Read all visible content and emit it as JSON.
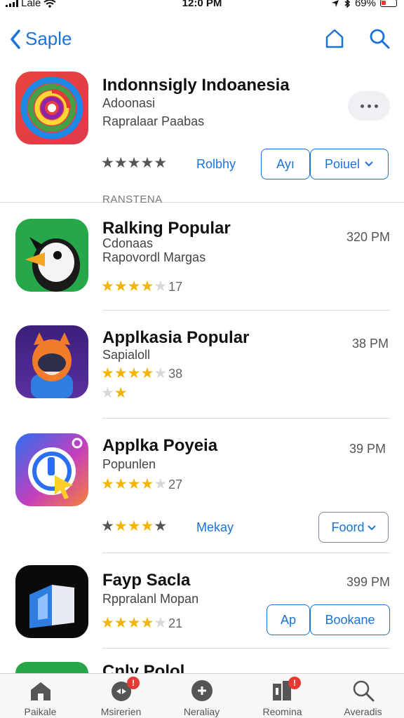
{
  "status": {
    "carrier": "Lale",
    "time": "12:0 PM",
    "battery": "69%"
  },
  "nav": {
    "back_label": "Saple"
  },
  "featured": {
    "title": "Indonnsigly Indoanesia",
    "subtitle1": "Adoonasi",
    "subtitle2": "Rapralaar Paabas",
    "rating_link": "Rolbhy",
    "btn1": "Ayı",
    "btn2": "Poiuel"
  },
  "section_label": "RANSTENA",
  "apps": [
    {
      "title": "Ralking Popular",
      "sub1": "Cdonaas",
      "sub2": "Rapovordl Margas",
      "rating": 4,
      "count": "17",
      "time": "320 PM"
    },
    {
      "title": "Applkasia Popular",
      "sub1": "Sapialoll",
      "rating": 4,
      "count": "38",
      "time": "38 PM"
    },
    {
      "title": "Applka Poyeia",
      "sub1": "Popunlen",
      "rating": 4,
      "count": "27",
      "time": "39 PM",
      "rating_link": "Mekay",
      "btn": "Foord"
    },
    {
      "title": "Fayp Sacla",
      "sub1": "Rppralanl Mopan",
      "rating": 4,
      "count": "21",
      "time": "399 PM",
      "btn1": "Ap",
      "btn2": "Bookane"
    },
    {
      "title": "Cnly Polol"
    }
  ],
  "tabs": [
    {
      "label": "Paikale",
      "icon": "home-icon"
    },
    {
      "label": "Msirerien",
      "icon": "games-icon",
      "badge": "!"
    },
    {
      "label": "Neraliay",
      "icon": "apps-icon"
    },
    {
      "label": "Reomina",
      "icon": "library-icon",
      "badge": "!"
    },
    {
      "label": "Averadis",
      "icon": "search-icon"
    }
  ],
  "colors": {
    "accent": "#1a73d9",
    "star": "#f5b400",
    "badge": "#e53935"
  }
}
